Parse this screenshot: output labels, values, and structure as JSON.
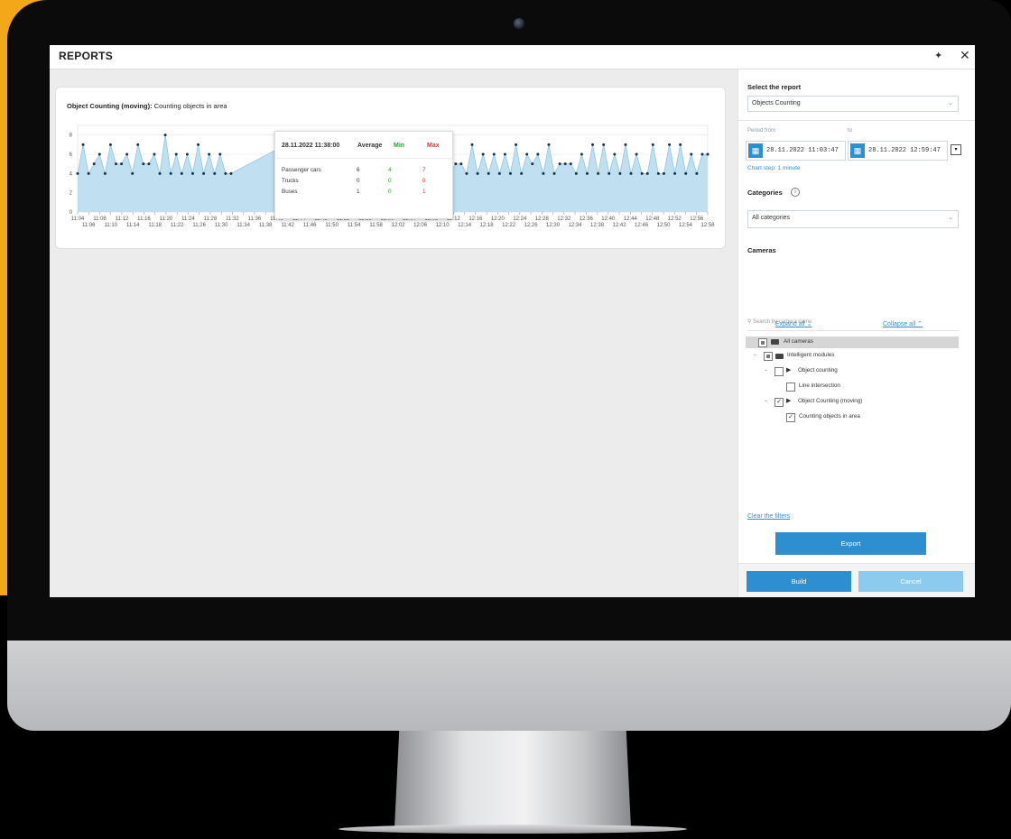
{
  "window": {
    "title": "REPORTS"
  },
  "chart_card": {
    "title_bold": "Object Counting  (moving):",
    "title_rest": " Counting objects in area"
  },
  "chart_data": {
    "type": "area",
    "y_ticks": [
      "0",
      "2",
      "4",
      "6",
      "8"
    ],
    "ylim": [
      0,
      9
    ],
    "x_ticks_top": [
      "11:04",
      "11:08",
      "11:12",
      "11:16",
      "11:20",
      "11:24",
      "11:28",
      "11:32",
      "11:36",
      "11:40",
      "11:44",
      "11:48",
      "11:52",
      "11:56",
      "12:00",
      "12:04",
      "12:08",
      "12:12",
      "12:16",
      "12:20",
      "12:24",
      "12:28",
      "12:32",
      "12:36",
      "12:40",
      "12:44",
      "12:48",
      "12:52",
      "12:56"
    ],
    "x_ticks_bottom": [
      "11:06",
      "11:10",
      "11:14",
      "11:18",
      "11:22",
      "11:26",
      "11:30",
      "11:34",
      "11:38",
      "11:42",
      "11:46",
      "11:50",
      "11:54",
      "11:58",
      "12:02",
      "12:06",
      "12:10",
      "12:14",
      "12:18",
      "12:22",
      "12:26",
      "12:30",
      "12:34",
      "12:38",
      "12:42",
      "12:46",
      "12:50",
      "12:54",
      "12:58"
    ],
    "series": [
      {
        "values": [
          4,
          7,
          4,
          5,
          6,
          4,
          7,
          5,
          5,
          6,
          4,
          7,
          5,
          5,
          6,
          4,
          8,
          4,
          6,
          4,
          6,
          4,
          7,
          4,
          6,
          4,
          6,
          4,
          4,
          null,
          null,
          null,
          null,
          null,
          null,
          null,
          null,
          null,
          7,
          4,
          7,
          4,
          6,
          4,
          7,
          4,
          7,
          4,
          7,
          4,
          6,
          6,
          4,
          6,
          6,
          4,
          7,
          4,
          6,
          4,
          6,
          6,
          4,
          7,
          4,
          7,
          4,
          7,
          4,
          5,
          5,
          4,
          7,
          4,
          6,
          4,
          6,
          4,
          6,
          4,
          7,
          4,
          6,
          5,
          6,
          4,
          7,
          4,
          5,
          5,
          5,
          4,
          6,
          4,
          7,
          4,
          7,
          4,
          6,
          4,
          7,
          4,
          6,
          4,
          4,
          7,
          4,
          4,
          7,
          4,
          7,
          4,
          6,
          4,
          6,
          6
        ]
      }
    ]
  },
  "tooltip": {
    "title": "28.11.2022 11:38:00",
    "headers": {
      "average": "Average",
      "min": "Min",
      "max": "Max"
    },
    "rows": [
      {
        "label": "Passenger cars",
        "average": "6",
        "min": "4",
        "max": "7"
      },
      {
        "label": "Trucks",
        "average": "0",
        "min": "0",
        "max": "0"
      },
      {
        "label": "Buses",
        "average": "1",
        "min": "0",
        "max": "1"
      }
    ],
    "colors": {
      "min": "#2e9a2e",
      "max": "#d9342b"
    }
  },
  "panel": {
    "select_report_label": "Select the report",
    "report_value": "Objects Counting",
    "period_from_label": "Period from",
    "period_to_label": "to",
    "date_from": "28.11.2022  11:03:47",
    "date_to": "28.11.2022  12:59:47",
    "chart_step": "Chart step: 1 minute",
    "categories_label": "Categories",
    "categories_value": "All categories",
    "cameras_label": "Cameras",
    "search_placeholder": "Search by camera name",
    "expand_all": "Expand all",
    "collapse_all": "Collapse all",
    "tree": {
      "all_cameras": "All cameras",
      "intelligent_modules": "Intelligent modules",
      "object_counting": "Object counting",
      "line_intersection": "Line intersection",
      "object_counting_moving": "Object Counting  (moving)",
      "counting_objects_in_area": "Counting objects in area"
    },
    "clear_filters": "Clear the filters",
    "export": "Export",
    "build": "Build",
    "cancel": "Cancel"
  },
  "colors": {
    "accent": "#2e8fd0",
    "brand_orange": "#f3a81a",
    "area_fill": "#b9ddf0",
    "point": "#17324a"
  }
}
